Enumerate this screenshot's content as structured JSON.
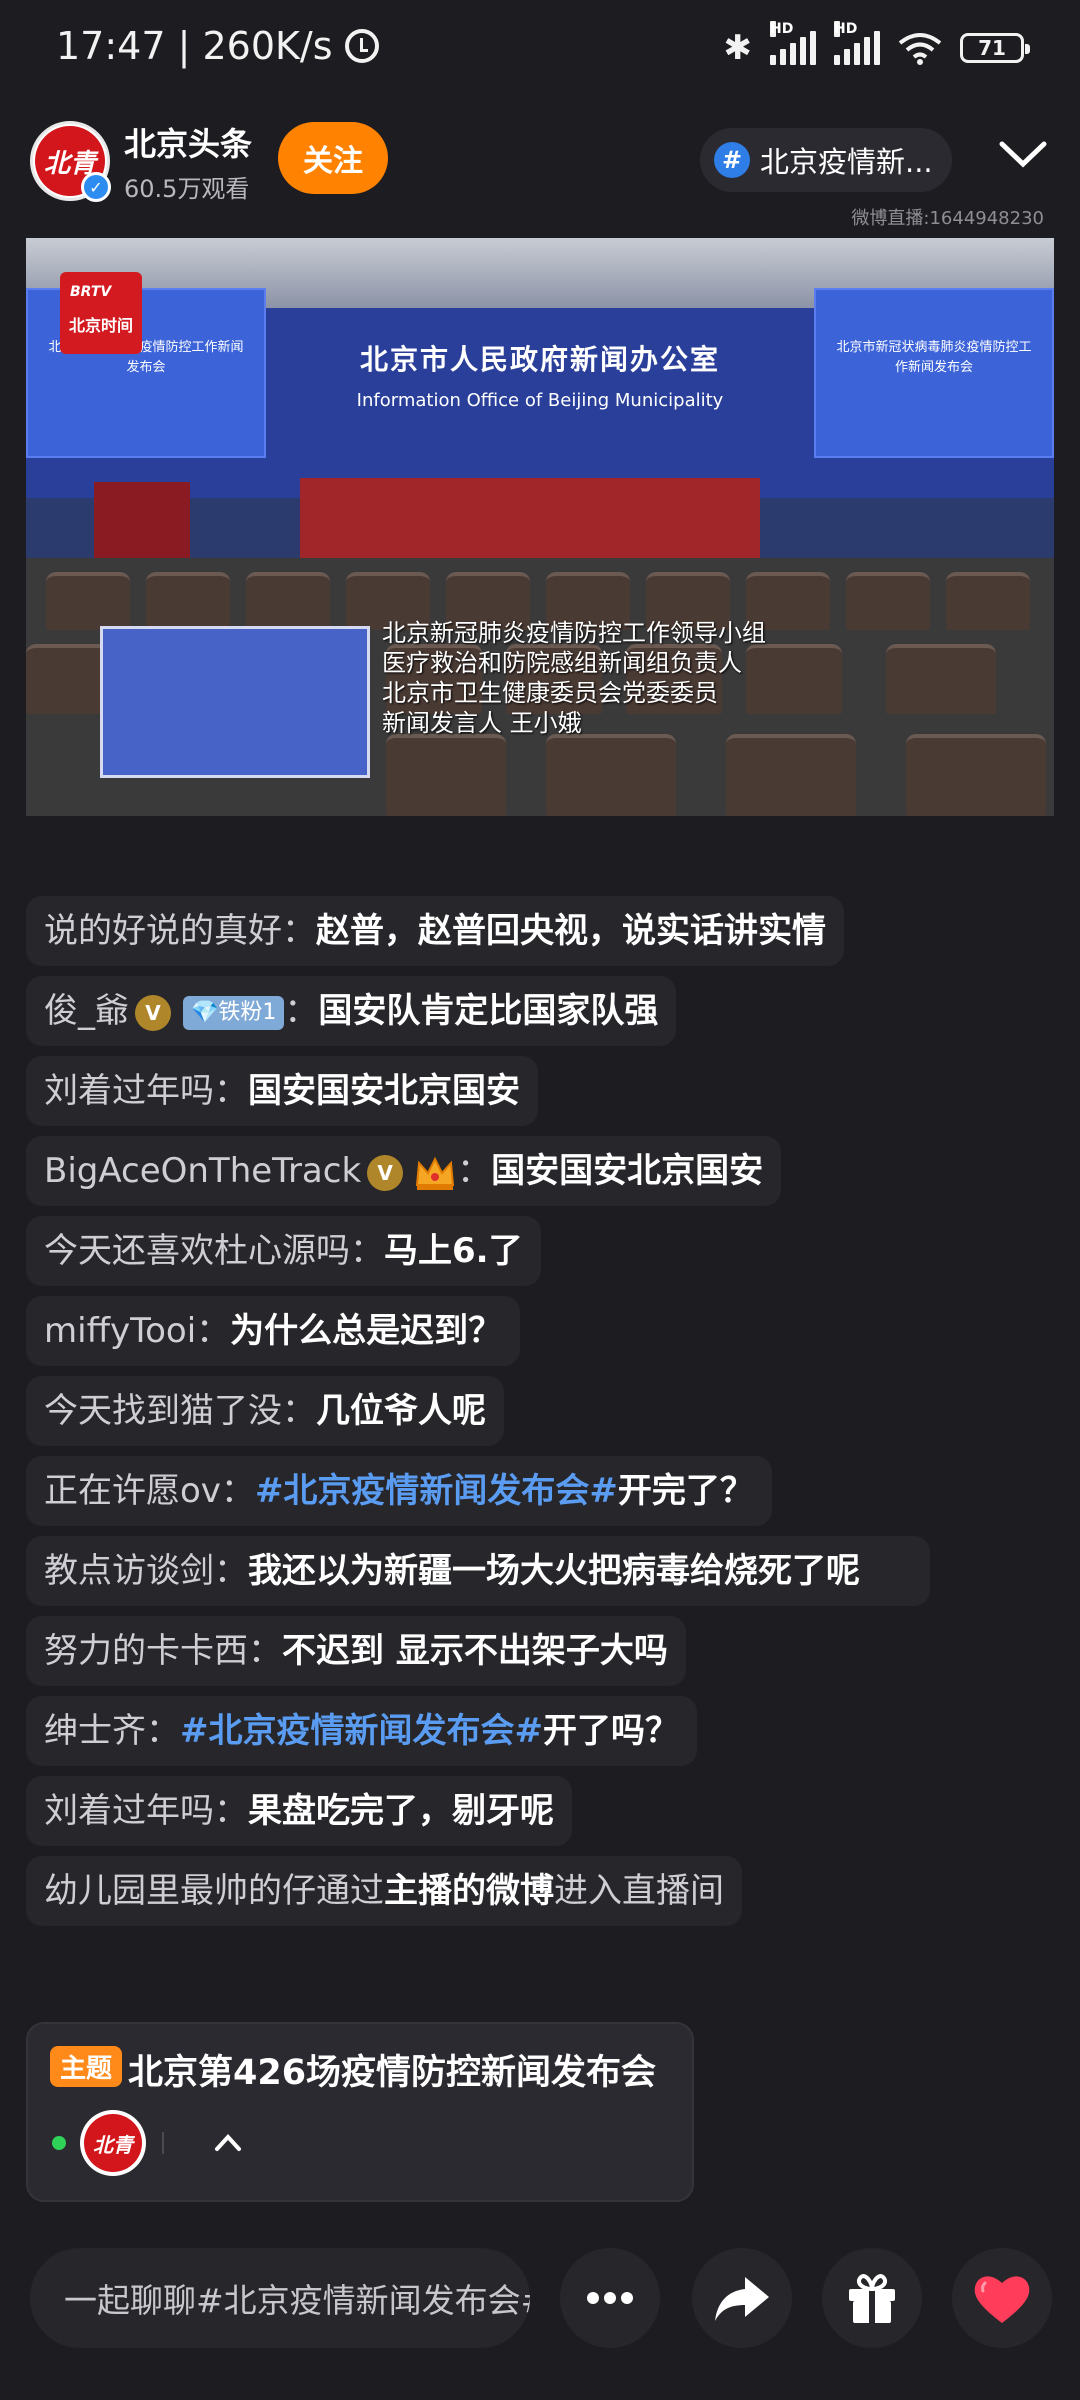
{
  "status": {
    "time_speed": "17:47 | 260K/s",
    "battery": "71",
    "signal_label_1": "HD",
    "signal_label_2": "HD"
  },
  "host": {
    "avatar_text": "北青",
    "name": "北京头条",
    "views": "60.5万观看",
    "follow_label": "关注"
  },
  "topic_pill": {
    "hash": "#",
    "text": "北京疫情新..."
  },
  "weibo_id": "微博直播:1644948230",
  "video": {
    "logo_top": "BRTV",
    "logo_text": "北京时间",
    "screen_left_text": "北京市新冠肺炎疫情防控工作新闻发布会",
    "screen_right_text": "北京市新冠状病毒肺炎疫情防控工作新闻发布会",
    "center_title_cn": "北京市人民政府新闻办公室",
    "center_title_en": "Information Office of Beijing Municipality",
    "caption_line1": "北京新冠肺炎疫情防控工作领导小组",
    "caption_line2": "医疗救治和防院感组新闻组负责人",
    "caption_line3": "北京市卫生健康委员会党委委员",
    "caption_line4": "新闻发言人   王小娥"
  },
  "chat": {
    "messages": [
      {
        "user": "说的好说的真好：",
        "text": "赵普，赵普回央视，说实话讲实情"
      },
      {
        "user": "俊_爺",
        "vip": "V",
        "fan_badge": "💎铁粉1",
        "text": "国安队肯定比国家队强"
      },
      {
        "user": "刘着过年吗：",
        "text": "国安国安北京国安"
      },
      {
        "user": "BigAceOnTheTrack",
        "vip": "V",
        "text": "国安国安北京国安"
      },
      {
        "user": "今天还喜欢杜心源吗：",
        "text": "马上6.了"
      },
      {
        "user": "miffyTooi：",
        "text": "为什么总是迟到？"
      },
      {
        "user": "今天找到猫了没：",
        "text": "几位爷人呢"
      },
      {
        "user": "正在许愿ov：",
        "tag": "#北京疫情新闻发布会#",
        "text": "开完了？"
      },
      {
        "user": "教点访谈剑：",
        "text": "我还以为新疆一场大火把病毒给烧死了呢"
      },
      {
        "user": "努力的卡卡西：",
        "text": "不迟到 显示不出架子大吗"
      },
      {
        "user": "绅士齐：",
        "tag": "#北京疫情新闻发布会#",
        "text": "开了吗？"
      },
      {
        "user": "刘着过年吗：",
        "text": "果盘吃完了，剔牙呢"
      },
      {
        "pre": "幼儿园里最帅的仔通过",
        "bold": "主播的微博",
        "post": "进入直播间"
      }
    ]
  },
  "topic_card": {
    "tag": "主题",
    "title": "北京第426场疫情防控新闻发布会",
    "avatar_text": "北青"
  },
  "bottom": {
    "input_placeholder": "一起聊聊#北京疫情新闻发布会#"
  }
}
